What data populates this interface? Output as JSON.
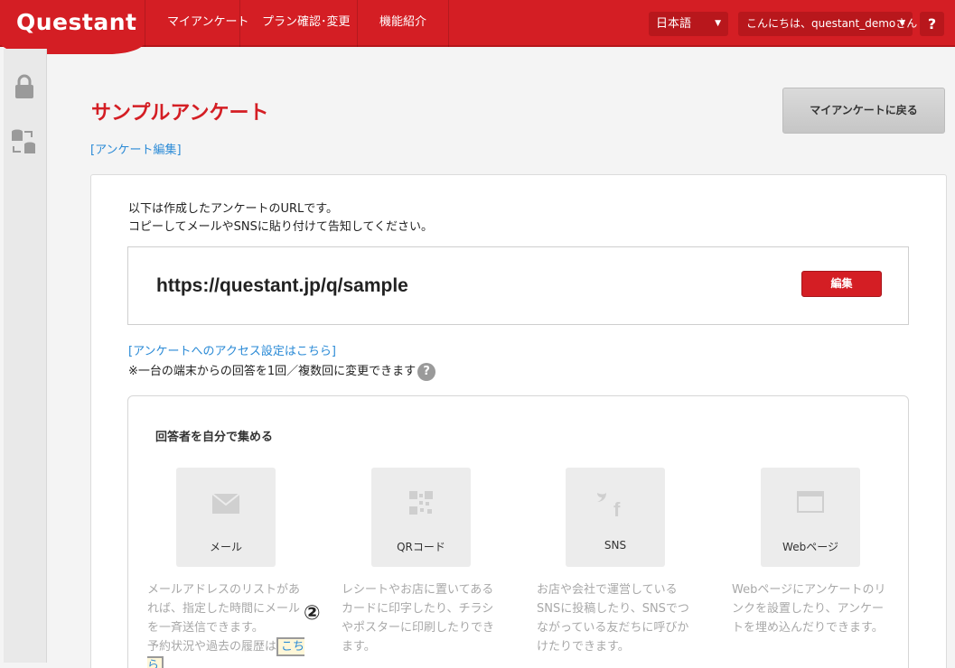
{
  "header": {
    "logo": "Questant",
    "nav": [
      "マイアンケート",
      "プラン確認･変更",
      "機能紹介"
    ],
    "language": "日本語",
    "greeting": "こんにちは、questant_demoさん",
    "help": "?"
  },
  "page": {
    "title": "サンプルアンケート",
    "edit_link": "[アンケート編集]",
    "back_button": "マイアンケートに戻る"
  },
  "url_section": {
    "intro_line1": "以下は作成したアンケートのURLです。",
    "intro_line2": "コピーしてメールやSNSに貼り付けて告知してください。",
    "url": "https://questant.jp/q/sample",
    "edit_button": "編集",
    "access_link": "[アンケートへのアクセス設定はこちら]",
    "note": "※一台の端末からの回答を1回／複数回に変更できます",
    "note_help": "?"
  },
  "collect": {
    "title": "回答者を自分で集める",
    "methods": [
      {
        "label": "メール",
        "icon": "mail-icon",
        "desc": "メールアドレスのリストがあれば、指定した時間にメールを一斉送信できます。",
        "desc_extra": "予約状況や過去の履歴は",
        "desc_link": "こちら"
      },
      {
        "label": "QRコード",
        "icon": "qr-code-icon",
        "desc": "レシートやお店に置いてあるカードに印字したり、チラシやポスターに印刷したりできます。"
      },
      {
        "label": "SNS",
        "icon": "social-icon",
        "desc": "お店や会社で運営しているSNSに投稿したり、SNSでつながっている友だちに呼びかけたりできます。"
      },
      {
        "label": "Webページ",
        "icon": "webpage-icon",
        "desc": "Webページにアンケートのリンクを設置したり、アンケートを埋め込んだりできます。"
      }
    ],
    "marker": "②"
  },
  "colors": {
    "brand_red": "#d41e24",
    "link_blue": "#2a8ad6"
  }
}
